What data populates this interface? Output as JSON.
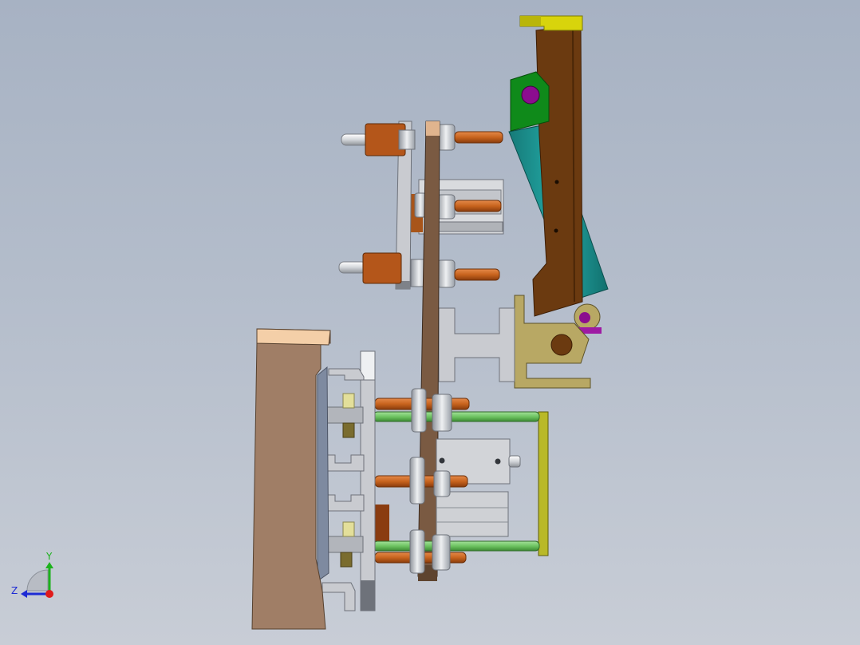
{
  "viewport": {
    "background_top": "#a7b2c3",
    "background_bottom": "#c8cdd6"
  },
  "triad": {
    "y_label": "Y",
    "z_label": "Z",
    "y_color": "#1db21d",
    "z_color": "#1d2bd4",
    "x_color": "#e01b1b"
  },
  "part_colors": {
    "cylinder_body": "#1e9a98",
    "arm_bracket": "#0f8a1a",
    "pin": "#8b0d8f",
    "top_cap": "#d8d40c",
    "frame": "#6b3a10",
    "shaft": "#c8641e",
    "green_rod": "#6ec462",
    "end_plate": "#b9b928",
    "base_block": "#a07e66",
    "plate": "#c9cbd0"
  }
}
